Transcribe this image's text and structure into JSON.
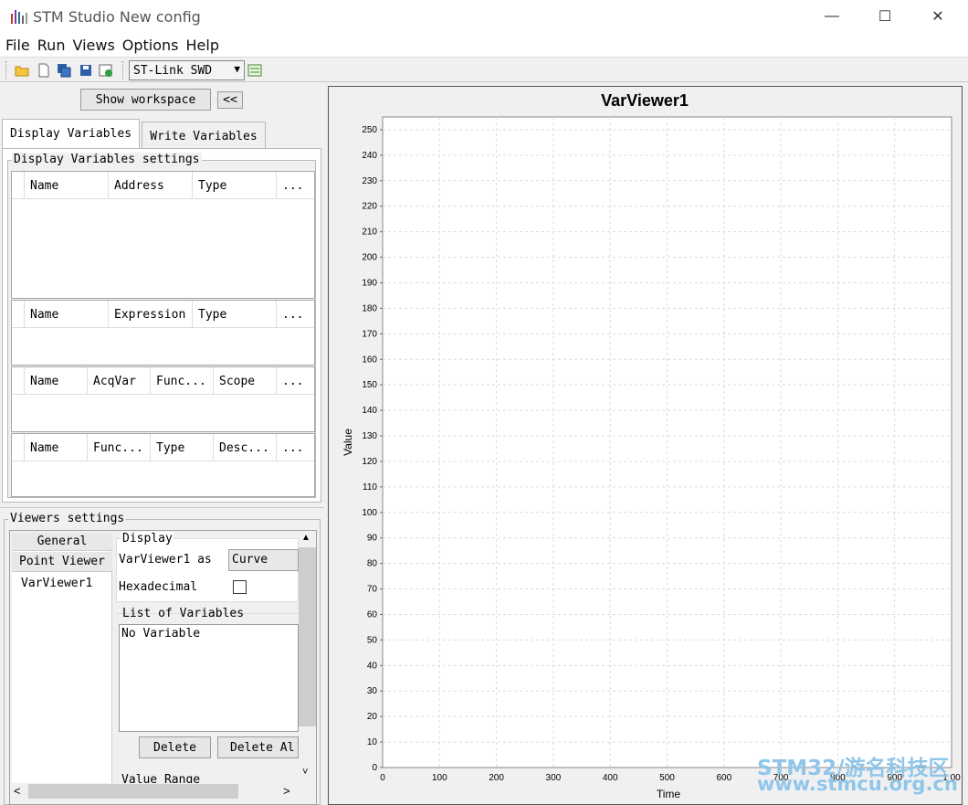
{
  "window": {
    "title": "STM Studio New config",
    "icon": "bar-chart-icon",
    "controls": {
      "minimize": "—",
      "maximize": "☐",
      "close": "✕"
    }
  },
  "menu": [
    "File",
    "Run",
    "Views",
    "Options",
    "Help"
  ],
  "toolbar": {
    "icons": [
      "open-folder-icon",
      "new-file-icon",
      "save-as-icon",
      "save-icon",
      "export-icon",
      "probe-settings-icon"
    ],
    "probe": "ST-Link SWD"
  },
  "left_panel": {
    "show_workspace": "Show workspace",
    "collapse": "<<",
    "tabs": [
      "Display Variables",
      "Write Variables"
    ],
    "display_settings": {
      "title": "Display Variables settings",
      "table1": [
        "Name",
        "Address",
        "Type",
        "..."
      ],
      "table2": [
        "Name",
        "Expression",
        "Type",
        "..."
      ],
      "table3": [
        "Name",
        "AcqVar",
        "Func...",
        "Scope",
        "..."
      ],
      "table4": [
        "Name",
        "Func...",
        "Type",
        "Desc...",
        "..."
      ]
    },
    "viewers": {
      "title": "Viewers settings",
      "categories": [
        "General",
        "Point Viewer"
      ],
      "viewer_item": "VarViewer1",
      "display_group": "Display",
      "as_label": "VarViewer1 as",
      "as_value": "Curve",
      "hex_label": "Hexadecimal",
      "list_title": "List of Variables",
      "list_empty": "No Variable",
      "delete": "Delete",
      "delete_all": "Delete Al",
      "value_range": "Value Range"
    }
  },
  "chart_data": {
    "type": "line",
    "title": "VarViewer1",
    "xlabel": "Time",
    "ylabel": "Value",
    "xlim": [
      0,
      1000
    ],
    "ylim": [
      0,
      255
    ],
    "x_ticks": [
      "0",
      "100",
      "200",
      "300",
      "400",
      "500",
      "600",
      "700",
      "800",
      "900",
      "1 00"
    ],
    "y_ticks": [
      "0",
      "10",
      "20",
      "30",
      "40",
      "50",
      "60",
      "70",
      "80",
      "90",
      "100",
      "110",
      "120",
      "130",
      "140",
      "150",
      "160",
      "170",
      "180",
      "190",
      "200",
      "210",
      "220",
      "230",
      "240",
      "250"
    ],
    "grid": true,
    "series": []
  },
  "watermark": {
    "line1": "STM32/游名科技区",
    "line2": "www.stmcu.org.cn"
  }
}
